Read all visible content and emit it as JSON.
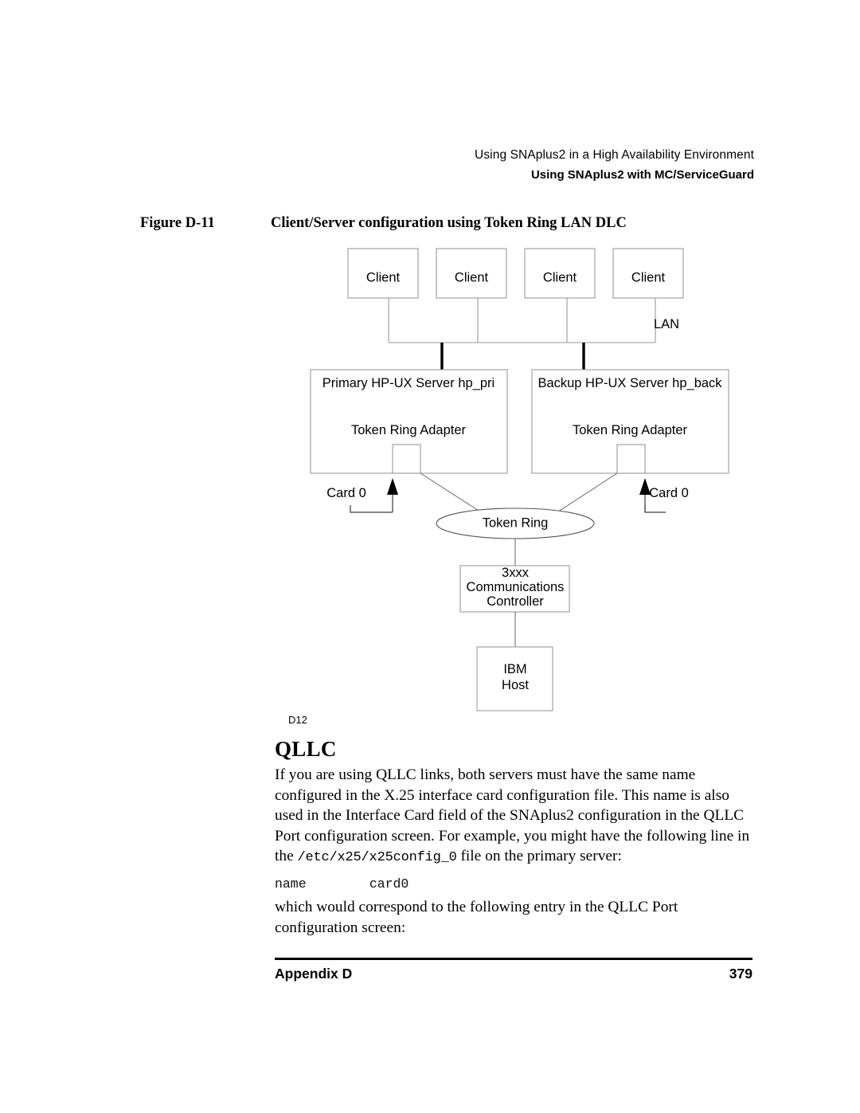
{
  "header": {
    "line1": "Using SNAplus2 in a High Availability Environment",
    "line2": "Using SNAplus2 with MC/ServiceGuard"
  },
  "figure": {
    "number": "Figure D-11",
    "title": "Client/Server configuration using Token Ring LAN DLC",
    "id_label": "D12",
    "clients": [
      {
        "label": "Client"
      },
      {
        "label": "Client"
      },
      {
        "label": "Client"
      },
      {
        "label": "Client"
      }
    ],
    "lan_label": "LAN",
    "servers": [
      {
        "title": "Primary HP-UX Server hp_pri",
        "adapter": "Token Ring Adapter",
        "card_label": "Card 0"
      },
      {
        "title": "Backup HP-UX Server hp_back",
        "adapter": "Token Ring Adapter",
        "card_label": "Card 0"
      }
    ],
    "ring_label": "Token Ring",
    "controller": {
      "line1": "3xxx",
      "line2": "Communications",
      "line3": "Controller"
    },
    "host": {
      "line1": "IBM",
      "line2": "Host"
    }
  },
  "content": {
    "heading": "QLLC",
    "paragraph1_part1": "If you are using QLLC links, both servers must have the same name configured in the X.25 interface card configuration file. This name is also used in the Interface Card field of the SNAplus2 configuration in the QLLC Port configuration screen. For example, you might have the following line in the ",
    "paragraph1_mono": "/etc/x25/x25config_0",
    "paragraph1_part2": " file on the primary server:",
    "code_line": "name        card0",
    "paragraph2": "which would correspond to the following entry in the QLLC Port configuration screen:"
  },
  "footer": {
    "left": "Appendix D",
    "right": "379"
  }
}
